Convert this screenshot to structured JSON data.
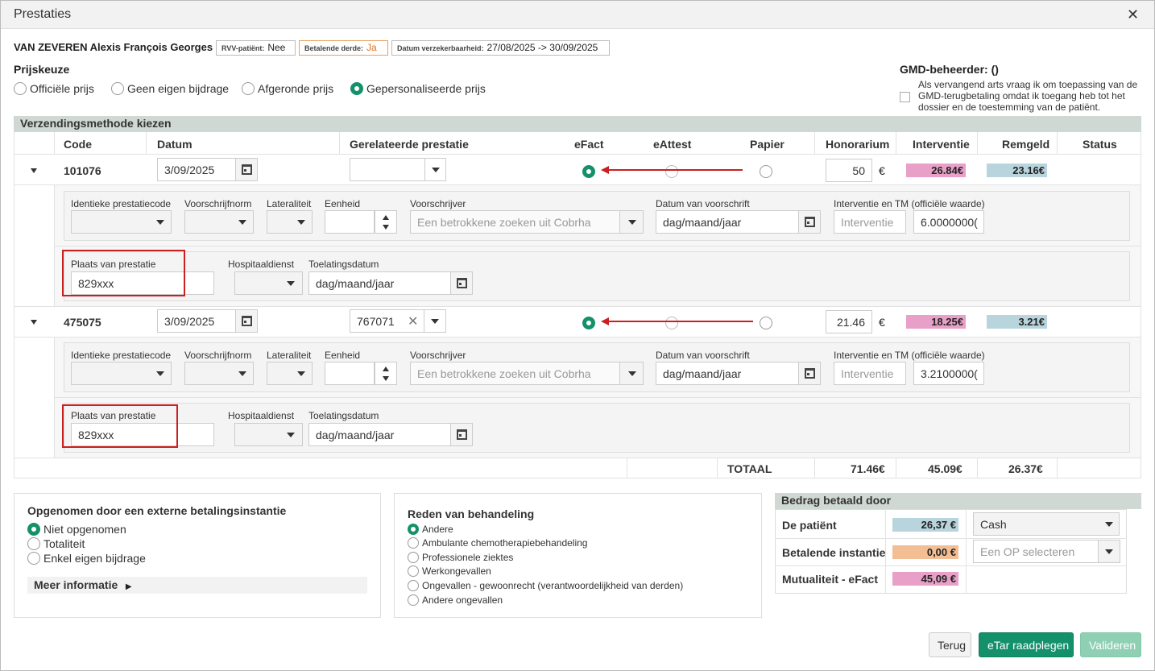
{
  "window": {
    "title": "Prestaties"
  },
  "patient": {
    "name": "VAN ZEVEREN Alexis François Georges",
    "rvv_label": "RVV-patiënt:",
    "rvv_value": "Nee",
    "betalende_label": "Betalende derde:",
    "betalende_value": "Ja",
    "verzekerbaarheid_label": "Datum verzekerbaarheid:",
    "verzekerbaarheid_value": "27/08/2025 -> 30/09/2025"
  },
  "prijskeuze": {
    "label": "Prijskeuze",
    "options": [
      "Officiële prijs",
      "Geen eigen bijdrage",
      "Afgeronde prijs",
      "Gepersonaliseerde prijs"
    ],
    "selected": "Gepersonaliseerde prijs"
  },
  "gmd": {
    "label": "GMD-beheerder: ()",
    "checkbox_text_1": "Als vervangend arts vraag ik om toepassing van de",
    "checkbox_text_2": "GMD-terugbetaling omdat ik toegang heb tot het",
    "checkbox_text_3": "dossier en de toestemming van de patiënt."
  },
  "section_title": "Verzendingsmethode kiezen",
  "columns": {
    "code": "Code",
    "datum": "Datum",
    "gerelateerde": "Gerelateerde prestatie",
    "efact": "eFact",
    "eattest": "eAttest",
    "papier": "Papier",
    "honorarium": "Honorarium",
    "interventie": "Interventie",
    "remgeld": "Remgeld",
    "status": "Status"
  },
  "sub_labels": {
    "identieke": "Identieke prestatiecode",
    "voorschrijfnorm": "Voorschrijfnorm",
    "lateraliteit": "Lateraliteit",
    "eenheid": "Eenheid",
    "voorschrijver": "Voorschrijver",
    "voorschrijver_placeholder": "Een betrokkene zoeken uit Cobrha",
    "datum_voorschrift": "Datum van voorschrift",
    "date_placeholder": "dag/maand/jaar",
    "interventie_tm": "Interventie en TM (officiële waarde)",
    "interventie_placeholder": "Interventie",
    "plaats": "Plaats van prestatie",
    "hospitaal": "Hospitaaldienst",
    "toelating": "Toelatingsdatum"
  },
  "rows": [
    {
      "code": "101076",
      "datum": "3/09/2025",
      "gerelateerde": "",
      "honorarium": "50",
      "currency": "€",
      "interventie": "26.84€",
      "remgeld": "23.16€",
      "tm_value": "6.0000000(",
      "plaats": "829xxx"
    },
    {
      "code": "475075",
      "datum": "3/09/2025",
      "gerelateerde": "767071",
      "honorarium": "21.46",
      "currency": "€",
      "interventie": "18.25€",
      "remgeld": "3.21€",
      "tm_value": "3.2100000(",
      "plaats": "829xxx"
    }
  ],
  "totals": {
    "label": "TOTAAL",
    "honorarium": "71.46€",
    "interventie": "45.09€",
    "remgeld": "26.37€"
  },
  "externe": {
    "title": "Opgenomen door een externe betalingsinstantie",
    "options": [
      "Niet opgenomen",
      "Totaliteit",
      "Enkel eigen bijdrage"
    ],
    "selected": "Niet opgenomen",
    "meer": "Meer informatie"
  },
  "reden": {
    "title": "Reden van behandeling",
    "options": [
      "Andere",
      "Ambulante chemotherapiebehandeling",
      "Professionele ziektes",
      "Werkongevallen",
      "Ongevallen - gewoonrecht (verantwoordelijkheid van derden)",
      "Andere ongevallen"
    ],
    "selected": "Andere"
  },
  "betaald": {
    "title": "Bedrag betaald door",
    "patient_label": "De patiënt",
    "patient_value": "26,37 €",
    "patient_method": "Cash",
    "instantie_label": "Betalende instantie",
    "instantie_value": "0,00 €",
    "instantie_placeholder": "Een OP selecteren",
    "mutualiteit_label": "Mutualiteit - eFact",
    "mutualiteit_value": "45,09 €"
  },
  "buttons": {
    "terug": "Terug",
    "etar": "eTar raadplegen",
    "valideren": "Valideren"
  },
  "colors": {
    "accent": "#14916a",
    "pink": "#e8a0c8",
    "blue": "#b8d4dc",
    "peach": "#f4be94",
    "annotation": "#cc1f1f"
  }
}
